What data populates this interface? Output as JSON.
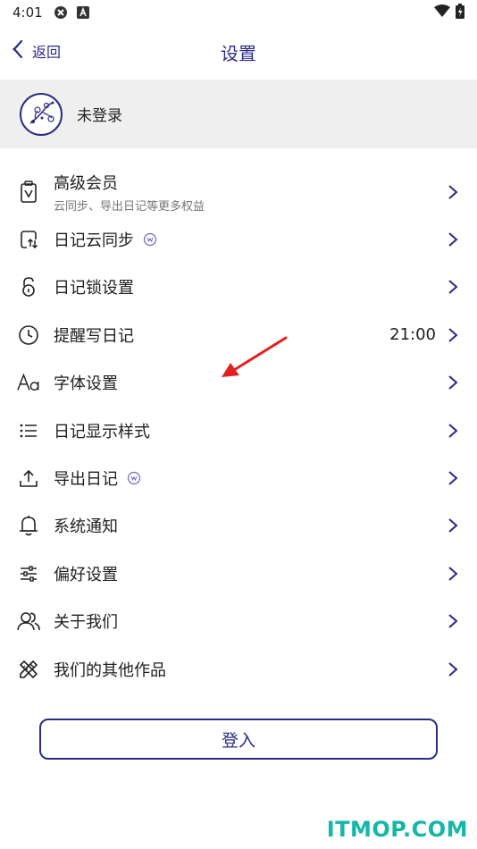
{
  "status_bar": {
    "time": "4:01"
  },
  "nav": {
    "back_label": "返回",
    "title": "设置"
  },
  "account": {
    "label": "未登录"
  },
  "settings": [
    {
      "name": "premium-member",
      "icon": "member-card-icon",
      "label": "高级会员",
      "subtitle": "云同步、导出日记等更多权益",
      "value": "",
      "badge": false
    },
    {
      "name": "diary-cloud-sync",
      "icon": "cloud-sync-icon",
      "label": "日记云同步",
      "subtitle": "",
      "value": "",
      "badge": true
    },
    {
      "name": "diary-lock",
      "icon": "lock-icon",
      "label": "日记锁设置",
      "subtitle": "",
      "value": "",
      "badge": false
    },
    {
      "name": "reminder",
      "icon": "clock-icon",
      "label": "提醒写日记",
      "subtitle": "",
      "value": "21:00",
      "badge": false
    },
    {
      "name": "font-settings",
      "icon": "font-icon",
      "label": "字体设置",
      "subtitle": "",
      "value": "",
      "badge": false
    },
    {
      "name": "display-style",
      "icon": "list-icon",
      "label": "日记显示样式",
      "subtitle": "",
      "value": "",
      "badge": false
    },
    {
      "name": "export-diary",
      "icon": "upload-icon",
      "label": "导出日记",
      "subtitle": "",
      "value": "",
      "badge": true
    },
    {
      "name": "system-notification",
      "icon": "bell-icon",
      "label": "系统通知",
      "subtitle": "",
      "value": "",
      "badge": false
    },
    {
      "name": "preferences",
      "icon": "sliders-icon",
      "label": "偏好设置",
      "subtitle": "",
      "value": "",
      "badge": false
    },
    {
      "name": "about-us",
      "icon": "people-icon",
      "label": "关于我们",
      "subtitle": "",
      "value": "",
      "badge": false
    },
    {
      "name": "other-works",
      "icon": "tools-icon",
      "label": "我们的其他作品",
      "subtitle": "",
      "value": "",
      "badge": false
    }
  ],
  "login_button": {
    "label": "登入"
  },
  "watermark": "ITMOP.COM",
  "colors": {
    "accent": "#2c2c86",
    "watermark": "#14b8a6",
    "annotation_arrow": "#e02020",
    "account_bg": "#efefef"
  }
}
